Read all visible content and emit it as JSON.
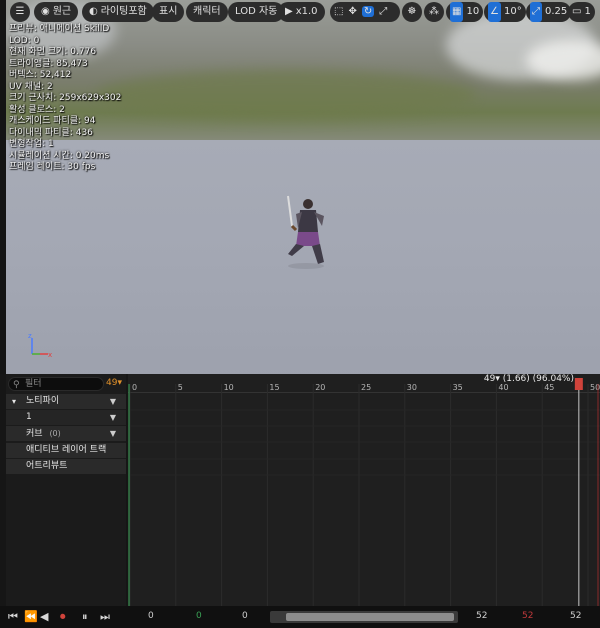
{
  "toolbar": {
    "menu_icon": "hamburger-icon",
    "perspective": "원근",
    "lighting": "라이팅포함",
    "show": "표시",
    "character": "캐릭터",
    "lod": "LOD 자동",
    "play_speed": "x1.0",
    "grid_size": "10",
    "rotation_snap": "10°",
    "scale_snap": "0.25",
    "camera_count": "1"
  },
  "stats": [
    "프리뷰: 애니메이션 SkillD",
    "LOD: 0",
    "현재 화면 크기: 0.776",
    "트라이앵글: 85,473",
    "버텍스: 52,412",
    "UV 채널: 2",
    "크기 근사치: 259x629x302",
    "활성 클로스: 2",
    "캐스케이드 파티클: 94",
    "다이내믹 파티클: 436",
    "변형작업: 1",
    "시뮬레이션 시간: 0.20ms",
    "프레임 레이트: 30 fps"
  ],
  "panel": {
    "filter_placeholder": "필터",
    "frame_badge": "49▾",
    "notify_track": "노티파이",
    "notify_sub": "1",
    "curves": "커브",
    "curves_count": "(0)",
    "additive_track": "애디티브 레이어 트랙",
    "attributes": "어트리뷰트"
  },
  "timeline": {
    "frame_info": "49▾ (1.66) (96.04%)",
    "ticks": [
      "0",
      "5",
      "10",
      "15",
      "20",
      "25",
      "30",
      "35",
      "40",
      "45",
      "50"
    ],
    "current_frame": 49,
    "max_frame": 50
  },
  "transport": {
    "n1": "0",
    "n2": "0",
    "n3": "0",
    "n4": "52",
    "n5": "52",
    "n6": "52"
  },
  "colors": {
    "accent_blue": "#1f6fd6",
    "playhead_red": "#d0433b",
    "frame_orange": "#e0902a"
  }
}
